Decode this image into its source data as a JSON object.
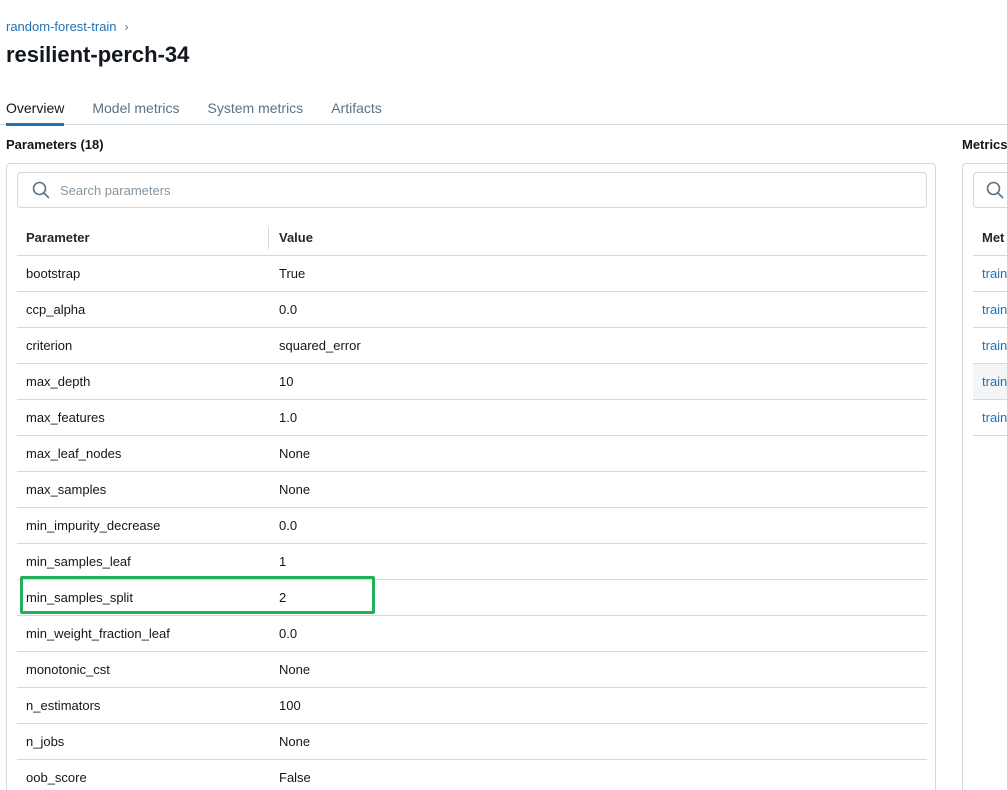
{
  "breadcrumb": {
    "experiment": "random-forest-train",
    "separator": "›"
  },
  "page_title": "resilient-perch-34",
  "tabs": [
    {
      "label": "Overview",
      "active": true
    },
    {
      "label": "Model metrics",
      "active": false
    },
    {
      "label": "System metrics",
      "active": false
    },
    {
      "label": "Artifacts",
      "active": false
    }
  ],
  "params": {
    "section_label": "Parameters (18)",
    "search_placeholder": "Search parameters",
    "columns": [
      "Parameter",
      "Value"
    ],
    "rows": [
      {
        "name": "bootstrap",
        "value": "True"
      },
      {
        "name": "ccp_alpha",
        "value": "0.0"
      },
      {
        "name": "criterion",
        "value": "squared_error"
      },
      {
        "name": "max_depth",
        "value": "10"
      },
      {
        "name": "max_features",
        "value": "1.0"
      },
      {
        "name": "max_leaf_nodes",
        "value": "None"
      },
      {
        "name": "max_samples",
        "value": "None"
      },
      {
        "name": "min_impurity_decrease",
        "value": "0.0"
      },
      {
        "name": "min_samples_leaf",
        "value": "1"
      },
      {
        "name": "min_samples_split",
        "value": "2"
      },
      {
        "name": "min_weight_fraction_leaf",
        "value": "0.0"
      },
      {
        "name": "monotonic_cst",
        "value": "None"
      },
      {
        "name": "n_estimators",
        "value": "100"
      },
      {
        "name": "n_jobs",
        "value": "None"
      },
      {
        "name": "oob_score",
        "value": "False"
      }
    ],
    "highlighted_row": "min_samples_split"
  },
  "metrics": {
    "section_label": "Metrics",
    "column_header": "Met",
    "rows": [
      "train",
      "train",
      "train",
      "train",
      "train"
    ]
  },
  "colors": {
    "accent": "#2272b4",
    "highlight_border": "#22b05a",
    "border": "#d1d9e1"
  },
  "icons": {
    "search": "search-icon",
    "chevron": "chevron-right-icon"
  }
}
